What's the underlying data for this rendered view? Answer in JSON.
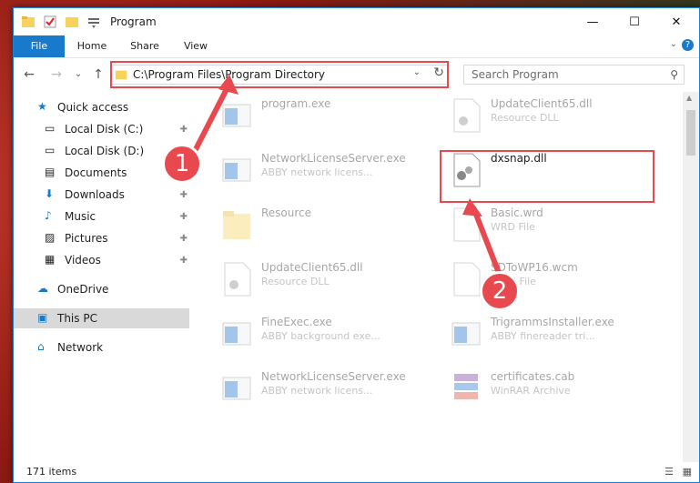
{
  "window": {
    "title": "Program"
  },
  "ribbon": {
    "tabs": [
      "File",
      "Home",
      "Share",
      "View"
    ]
  },
  "address": {
    "path": "C:\\Program Files\\Program Directory",
    "search_placeholder": "Search Program"
  },
  "sidebar": {
    "items": [
      {
        "label": "Quick access",
        "icon": "star-icon",
        "pinned": false
      },
      {
        "label": "Local Disk (C:)",
        "icon": "drive-icon",
        "pinned": true
      },
      {
        "label": "Local Disk (D:)",
        "icon": "drive-icon",
        "pinned": false
      },
      {
        "label": "Documents",
        "icon": "documents-icon",
        "pinned": true
      },
      {
        "label": "Downloads",
        "icon": "download-icon",
        "pinned": true
      },
      {
        "label": "Music",
        "icon": "music-icon",
        "pinned": true
      },
      {
        "label": "Pictures",
        "icon": "pictures-icon",
        "pinned": true
      },
      {
        "label": "Videos",
        "icon": "videos-icon",
        "pinned": true
      },
      {
        "label": "OneDrive",
        "icon": "cloud-icon",
        "pinned": false
      },
      {
        "label": "This PC",
        "icon": "pc-icon",
        "pinned": false
      },
      {
        "label": "Network",
        "icon": "network-icon",
        "pinned": false
      }
    ]
  },
  "files": [
    {
      "name": "program.exe",
      "type": "",
      "kind": "exe"
    },
    {
      "name": "UpdateClient65.dll",
      "type": "Resource DLL",
      "kind": "dll"
    },
    {
      "name": "NetworkLicenseServer.exe",
      "type": "ABBY network licens...",
      "kind": "exe"
    },
    {
      "name": "dxsnap.dll",
      "type": "",
      "kind": "dll"
    },
    {
      "name": "Resource",
      "type": "",
      "kind": "folder"
    },
    {
      "name": "Basic.wrd",
      "type": "WRD File",
      "kind": "file"
    },
    {
      "name": "UpdateClient65.dll",
      "type": "Resource DLL",
      "kind": "dll"
    },
    {
      "name": "SDToWP16.wcm",
      "type": "WCM File",
      "kind": "file"
    },
    {
      "name": "FineExec.exe",
      "type": "ABBY background exe...",
      "kind": "exe"
    },
    {
      "name": "TrigrammsInstaller.exe",
      "type": "ABBY finereader tri...",
      "kind": "exe"
    },
    {
      "name": "NetworkLicenseServer.exe",
      "type": "ABBY network licens...",
      "kind": "exe"
    },
    {
      "name": "certificates.cab",
      "type": "WinRAR Archive",
      "kind": "cab"
    }
  ],
  "status": {
    "count": "171 items"
  },
  "annotations": {
    "step1": "1",
    "step2": "2"
  },
  "colors": {
    "accent": "#1979ca",
    "highlight": "#e8494e"
  }
}
